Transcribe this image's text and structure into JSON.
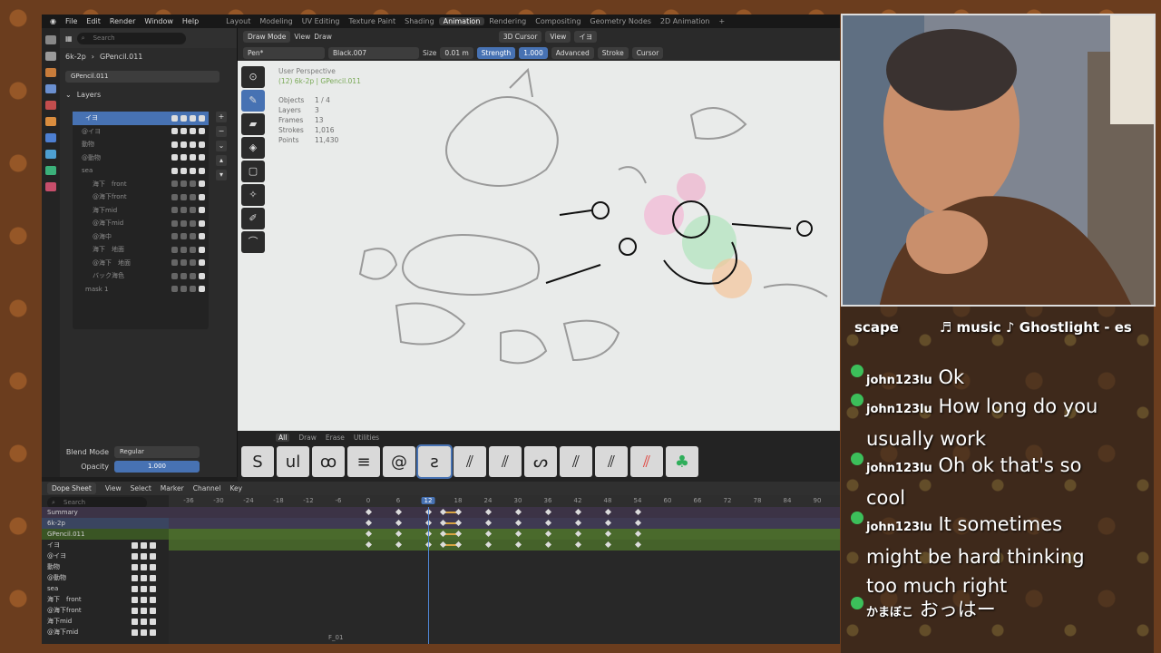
{
  "menubar": {
    "menus": [
      "File",
      "Edit",
      "Render",
      "Window",
      "Help"
    ],
    "workspaces": [
      "Layout",
      "Modeling",
      "UV Editing",
      "Texture Paint",
      "Shading",
      "Animation",
      "Rendering",
      "Compositing",
      "Geometry Nodes",
      "2D Animation",
      "+"
    ],
    "active_workspace": "Animation"
  },
  "props": {
    "search_placeholder": "Search",
    "breadcrumb_scene": "6k-2p",
    "breadcrumb_object": "GPencil.011",
    "data_name": "GPencil.011",
    "layers_title": "Layers",
    "layers": [
      {
        "name": "イヨ",
        "selected": true
      },
      {
        "name": "@イヨ"
      },
      {
        "name": "動物"
      },
      {
        "name": "@動物"
      },
      {
        "name": "sea"
      },
      {
        "name": "海下　front"
      },
      {
        "name": "@海下front"
      },
      {
        "name": "海下mid"
      },
      {
        "name": "@海下mid"
      },
      {
        "name": "@海中"
      },
      {
        "name": "海下　地面"
      },
      {
        "name": "@海下　地面"
      },
      {
        "name": "バック海色"
      },
      {
        "name": "mask 1"
      }
    ],
    "blend_mode_label": "Blend Mode",
    "blend_mode_value": "Regular",
    "opacity_label": "Opacity",
    "opacity_value": "1.000",
    "lights_label": "Lights"
  },
  "viewport_header": {
    "mode": "Draw Mode",
    "view": "View",
    "draw": "Draw",
    "brush": "Pen*",
    "material": "Black.007",
    "size_label": "Size",
    "size_value": "0.01 m",
    "strength_label": "Strength",
    "strength_value": "1.000",
    "advanced": "Advanced",
    "stroke": "Stroke",
    "cursor": "Cursor",
    "cursor3d": "3D Cursor",
    "view2": "View",
    "layer": "イヨ"
  },
  "viewport": {
    "perspective": "User Perspective",
    "frame_info": "(12) 6k-2p | GPencil.011",
    "stats": [
      {
        "label": "Objects",
        "value": "1 / 4"
      },
      {
        "label": "Layers",
        "value": "3"
      },
      {
        "label": "Frames",
        "value": "13"
      },
      {
        "label": "Strokes",
        "value": "1,016"
      },
      {
        "label": "Points",
        "value": "11,430"
      }
    ]
  },
  "brush_tabs": [
    "All",
    "Draw",
    "Erase",
    "Utilities"
  ],
  "brushes": [
    "S",
    "ul",
    "ꝏ",
    "≡",
    "@",
    "ƨ",
    "⫽",
    "⫽",
    "ᔕ",
    "⫽",
    "⫽",
    "⫽",
    "♣"
  ],
  "dope": {
    "editor": "Dope Sheet",
    "menus": [
      "View",
      "Select",
      "Marker",
      "Channel",
      "Key"
    ],
    "search_placeholder": "Search",
    "frames": [
      "-36",
      "-30",
      "-24",
      "-18",
      "-12",
      "-6",
      "0",
      "6",
      "12",
      "18",
      "24",
      "30",
      "36",
      "42",
      "48",
      "54",
      "60",
      "66",
      "72",
      "78",
      "84",
      "90",
      "96"
    ],
    "current_frame": "12",
    "marker": "F_01",
    "channels": [
      {
        "name": "Summary",
        "kind": "sum"
      },
      {
        "name": "6k-2p",
        "kind": "obj"
      },
      {
        "name": "GPencil.011",
        "kind": "gp"
      },
      {
        "name": "イヨ",
        "kind": "lay"
      },
      {
        "name": "@イヨ",
        "kind": "none"
      },
      {
        "name": "動物",
        "kind": "none"
      },
      {
        "name": "@動物",
        "kind": "none"
      },
      {
        "name": "sea",
        "kind": "none"
      },
      {
        "name": "海下　front",
        "kind": "none"
      },
      {
        "name": "@海下front",
        "kind": "none"
      },
      {
        "name": "海下mid",
        "kind": "none"
      },
      {
        "name": "@海下mid",
        "kind": "none"
      }
    ],
    "keyframes": [
      0,
      6,
      12,
      15,
      18,
      24,
      30,
      36,
      42,
      48,
      54
    ]
  },
  "chat": {
    "now_playing": "scape　　　♬ music ♪ Ghostlight - es",
    "messages": [
      {
        "user": "john123lu",
        "text": "Ok"
      },
      {
        "user": "john123lu",
        "text": "How long do you usually work"
      },
      {
        "user": "john123lu",
        "text": "Oh ok that's so cool"
      },
      {
        "user": "john123lu",
        "text": "It sometimes might be hard thinking too much right"
      },
      {
        "user": "かまぼこ",
        "text": "おっはー"
      }
    ]
  },
  "colors": {
    "accent": "#4772b3",
    "chat_dot": "#3cbf5a"
  }
}
